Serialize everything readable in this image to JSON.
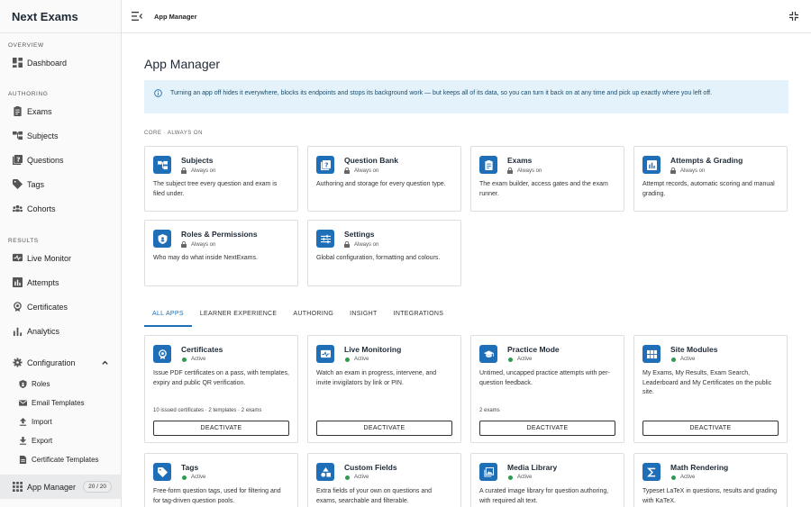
{
  "app": {
    "name": "Next Exams"
  },
  "sidebar": {
    "sections": {
      "overview": "OVERVIEW",
      "authoring": "AUTHORING",
      "results": "RESULTS"
    },
    "dashboard": "Dashboard",
    "exams": "Exams",
    "subjects": "Subjects",
    "questions": "Questions",
    "tags": "Tags",
    "cohorts": "Cohorts",
    "live_monitor": "Live Monitor",
    "attempts": "Attempts",
    "certificates": "Certificates",
    "analytics": "Analytics",
    "configuration": "Configuration",
    "roles": "Roles",
    "email_templates": "Email Templates",
    "import": "Import",
    "export": "Export",
    "certificate_templates": "Certificate Templates",
    "app_manager": "App Manager",
    "app_manager_count": "20 / 20"
  },
  "topbar": {
    "breadcrumb": "App Manager"
  },
  "page": {
    "title": "App Manager",
    "banner": "Turning an app off hides it everywhere, blocks its endpoints and stops its background work — but keeps all of its data, so you can turn it back on at any time and pick up exactly where you left off.",
    "core_label": "CORE · ALWAYS ON"
  },
  "core_apps": [
    {
      "name": "Subjects",
      "status": "Always on",
      "desc": "The subject tree every question and exam is filed under.",
      "icon": "tree-icon"
    },
    {
      "name": "Question Bank",
      "status": "Always on",
      "desc": "Authoring and storage for every question type.",
      "icon": "question-bank-icon"
    },
    {
      "name": "Exams",
      "status": "Always on",
      "desc": "The exam builder, access gates and the exam runner.",
      "icon": "clipboard-icon"
    },
    {
      "name": "Attempts & Grading",
      "status": "Always on",
      "desc": "Attempt records, automatic scoring and manual grading.",
      "icon": "bar-chart-icon"
    },
    {
      "name": "Roles & Permissions",
      "status": "Always on",
      "desc": "Who may do what inside NextExams.",
      "icon": "shield-icon"
    },
    {
      "name": "Settings",
      "status": "Always on",
      "desc": "Global configuration, formatting and colours.",
      "icon": "sliders-icon"
    }
  ],
  "tabs": [
    "ALL APPS",
    "LEARNER EXPERIENCE",
    "AUTHORING",
    "INSIGHT",
    "INTEGRATIONS"
  ],
  "apps": [
    {
      "name": "Certificates",
      "status": "Active",
      "desc": "Issue PDF certificates on a pass, with templates, expiry and public QR verification.",
      "meta": "10 issued certificates · 2 templates · 2 exams",
      "button": "DEACTIVATE",
      "icon": "certificate-icon"
    },
    {
      "name": "Live Monitoring",
      "status": "Active",
      "desc": "Watch an exam in progress, intervene, and invite invigilators by link or PIN.",
      "meta": "",
      "button": "DEACTIVATE",
      "icon": "monitor-icon"
    },
    {
      "name": "Practice Mode",
      "status": "Active",
      "desc": "Untimed, uncapped practice attempts with per-question feedback.",
      "meta": "2 exams",
      "button": "DEACTIVATE",
      "icon": "mortarboard-icon"
    },
    {
      "name": "Site Modules",
      "status": "Active",
      "desc": "My Exams, My Results, Exam Search, Leaderboard and My Certificates on the public site.",
      "meta": "",
      "button": "DEACTIVATE",
      "icon": "grid-icon"
    },
    {
      "name": "Tags",
      "status": "Active",
      "desc": "Free-form question tags, used for filtering and for tag-driven question pools.",
      "meta": "",
      "button": "",
      "icon": "tag-icon"
    },
    {
      "name": "Custom Fields",
      "status": "Active",
      "desc": "Extra fields of your own on questions and exams, searchable and filterable.",
      "meta": "",
      "button": "",
      "icon": "shapes-icon"
    },
    {
      "name": "Media Library",
      "status": "Active",
      "desc": "A curated image library for question authoring, with required alt text.",
      "meta": "",
      "button": "",
      "icon": "image-library-icon"
    },
    {
      "name": "Math Rendering",
      "status": "Active",
      "desc": "Typeset LaTeX in questions, results and grading with KaTeX.",
      "meta": "",
      "button": "",
      "icon": "sigma-icon"
    }
  ],
  "colors": {
    "accent": "#1e6fb8",
    "active_dot": "#2e9b4f",
    "banner_bg": "#e4f3fb"
  }
}
